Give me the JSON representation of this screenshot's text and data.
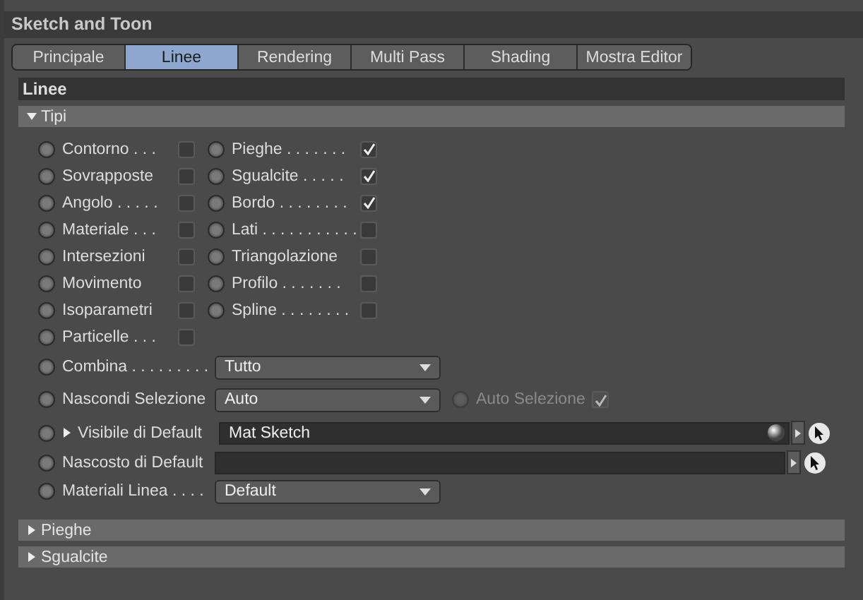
{
  "panel": {
    "title": "Sketch and Toon"
  },
  "tabs": [
    {
      "label": "Principale",
      "selected": false
    },
    {
      "label": "Linee",
      "selected": true
    },
    {
      "label": "Rendering",
      "selected": false
    },
    {
      "label": "Multi Pass",
      "selected": false
    },
    {
      "label": "Shading",
      "selected": false
    },
    {
      "label": "Mostra Editor",
      "selected": false
    }
  ],
  "section": {
    "title": "Linee"
  },
  "groups": [
    {
      "title": "Tipi",
      "expanded": true,
      "columns": [
        [
          {
            "label": "Contorno . . .",
            "checked": false
          },
          {
            "label": "Sovrapposte",
            "checked": false
          },
          {
            "label": "Angolo . . . . .",
            "checked": false
          },
          {
            "label": "Materiale . . .",
            "checked": false
          },
          {
            "label": "Intersezioni",
            "checked": false
          },
          {
            "label": "Movimento",
            "checked": false
          },
          {
            "label": "Isoparametri",
            "checked": false
          },
          {
            "label": "Particelle . . .",
            "checked": false
          }
        ],
        [
          {
            "label": "Pieghe . . . . . . .",
            "checked": true
          },
          {
            "label": "Sgualcite . . . . .",
            "checked": true
          },
          {
            "label": "Bordo . . . . . . . .",
            "checked": true
          },
          {
            "label": "Lati . . . . . . . . . . .",
            "checked": false
          },
          {
            "label": "Triangolazione",
            "checked": false
          },
          {
            "label": "Profilo . . . . . . .",
            "checked": false
          },
          {
            "label": "Spline . . . . . . . .",
            "checked": false
          }
        ]
      ],
      "fields": [
        {
          "kind": "dropdown",
          "label": "Combina . . . . . . . . .",
          "value": "Tutto"
        },
        {
          "kind": "dropdown",
          "label": "Nascondi Selezione",
          "value": "Auto",
          "extra": {
            "label": "Auto Selezione",
            "checked": true,
            "disabled": true
          }
        },
        {
          "kind": "link",
          "label": "Visibile di Default",
          "value": "Mat Sketch",
          "expandable": true,
          "preview": true
        },
        {
          "kind": "link",
          "label": "Nascosto di Default"
        },
        {
          "kind": "dropdown",
          "label": "Materiali Linea . . . .",
          "value": "Default"
        }
      ]
    },
    {
      "title": "Pieghe",
      "expanded": false
    },
    {
      "title": "Sgualcite",
      "expanded": false
    }
  ]
}
